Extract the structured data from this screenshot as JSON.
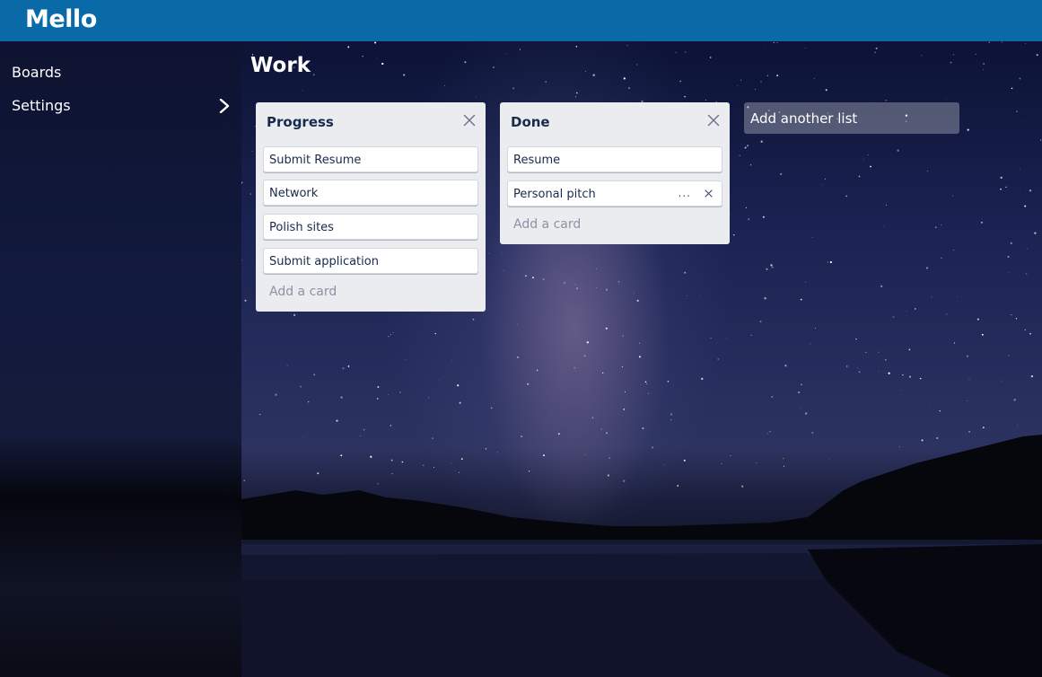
{
  "app": {
    "title": "Mello"
  },
  "sidebar": {
    "items": [
      {
        "label": "Boards",
        "has_chevron": false
      },
      {
        "label": "Settings",
        "has_chevron": true,
        "icon": "chevron-right-icon"
      }
    ]
  },
  "board": {
    "title": "Work",
    "lists": [
      {
        "title": "Progress",
        "cards": [
          "Submit Resume",
          "Network",
          "Polish sites",
          "Submit application"
        ],
        "add_card_label": "Add a card"
      },
      {
        "title": "Done",
        "cards": [
          "Resume",
          "Personal pitch"
        ],
        "hovered_card": {
          "more_label": "...",
          "icon": "close-icon"
        },
        "add_card_label": "Add a card"
      }
    ],
    "add_list_label": "Add another list"
  },
  "colors": {
    "topbar": "#0a6aa8",
    "list_bg": "#ebecf0",
    "card_bg": "#ffffff",
    "title_text": "#172b4d",
    "muted_text": "#8993a4"
  },
  "icons": {
    "list_close": "close-icon",
    "sidebar_chevron": "chevron-right-icon"
  }
}
